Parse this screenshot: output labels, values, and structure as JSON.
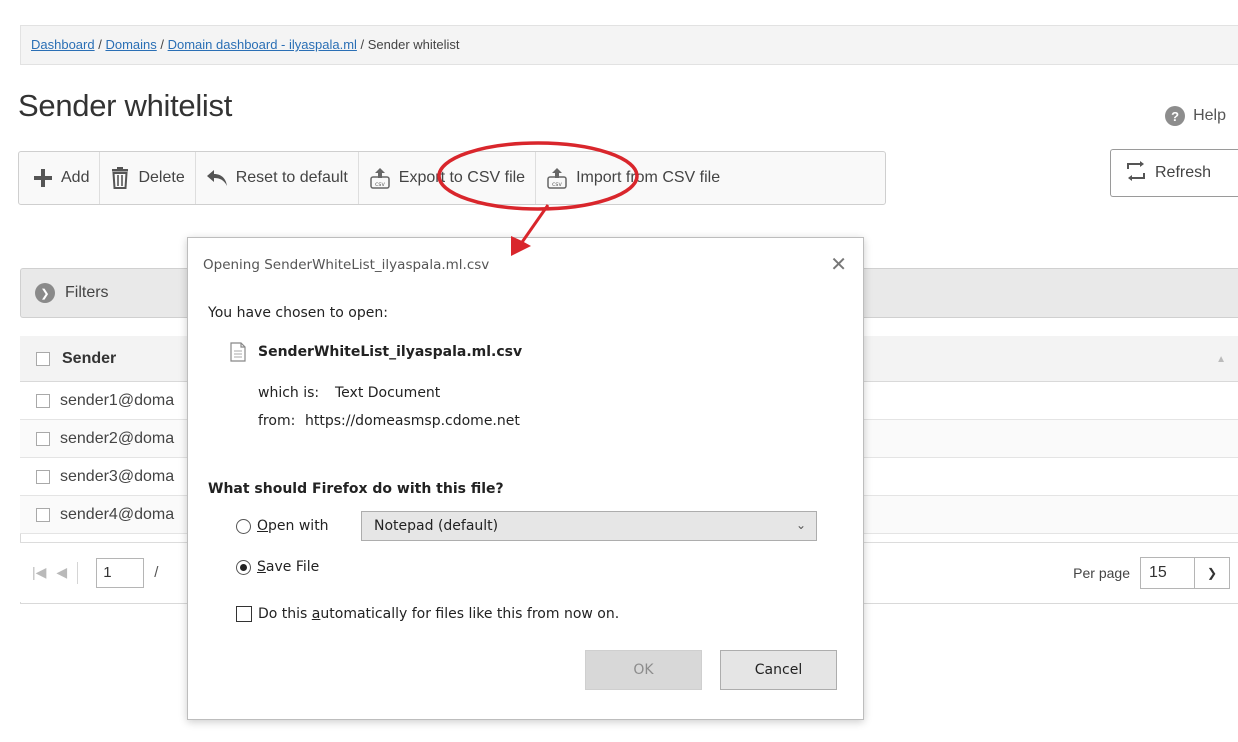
{
  "breadcrumb": {
    "link1": "Dashboard",
    "link2": "Domains",
    "link3": "Domain dashboard - ilyaspala.ml",
    "sep": " / ",
    "current": "Sender whitelist"
  },
  "page": {
    "title": "Sender whitelist",
    "help": "Help"
  },
  "toolbar": {
    "add": "Add",
    "delete": "Delete",
    "reset": "Reset to default",
    "export": "Export to CSV file",
    "import": "Import from CSV file"
  },
  "refresh": "Refresh",
  "filters": "Filters",
  "grid": {
    "column": "Sender",
    "rows": [
      "sender1@doma",
      "sender2@doma",
      "sender3@doma",
      "sender4@doma"
    ]
  },
  "pager": {
    "page": "1",
    "slash": "/",
    "per_page_label": "Per page",
    "per_page_value": "15"
  },
  "dialog": {
    "title": "Opening SenderWhiteList_ilyaspala.ml.csv",
    "intro": "You have chosen to open:",
    "filename": "SenderWhiteList_ilyaspala.ml.csv",
    "which_is_label": "which is:",
    "which_is_value": "Text Document",
    "from_label": "from:",
    "from_value": "https://domeasmsp.cdome.net",
    "question": "What should Firefox do with this file?",
    "open_with_pre": "",
    "open_with_key": "O",
    "open_with_post": "pen with",
    "open_with_app": "Notepad (default)",
    "save_key": "S",
    "save_post": "ave File",
    "auto_pre": "Do this ",
    "auto_key": "a",
    "auto_post": "utomatically for files like this from now on.",
    "ok": "OK",
    "cancel": "Cancel"
  },
  "colors": {
    "link": "#2a6fb5",
    "annotation": "#d9262c"
  }
}
